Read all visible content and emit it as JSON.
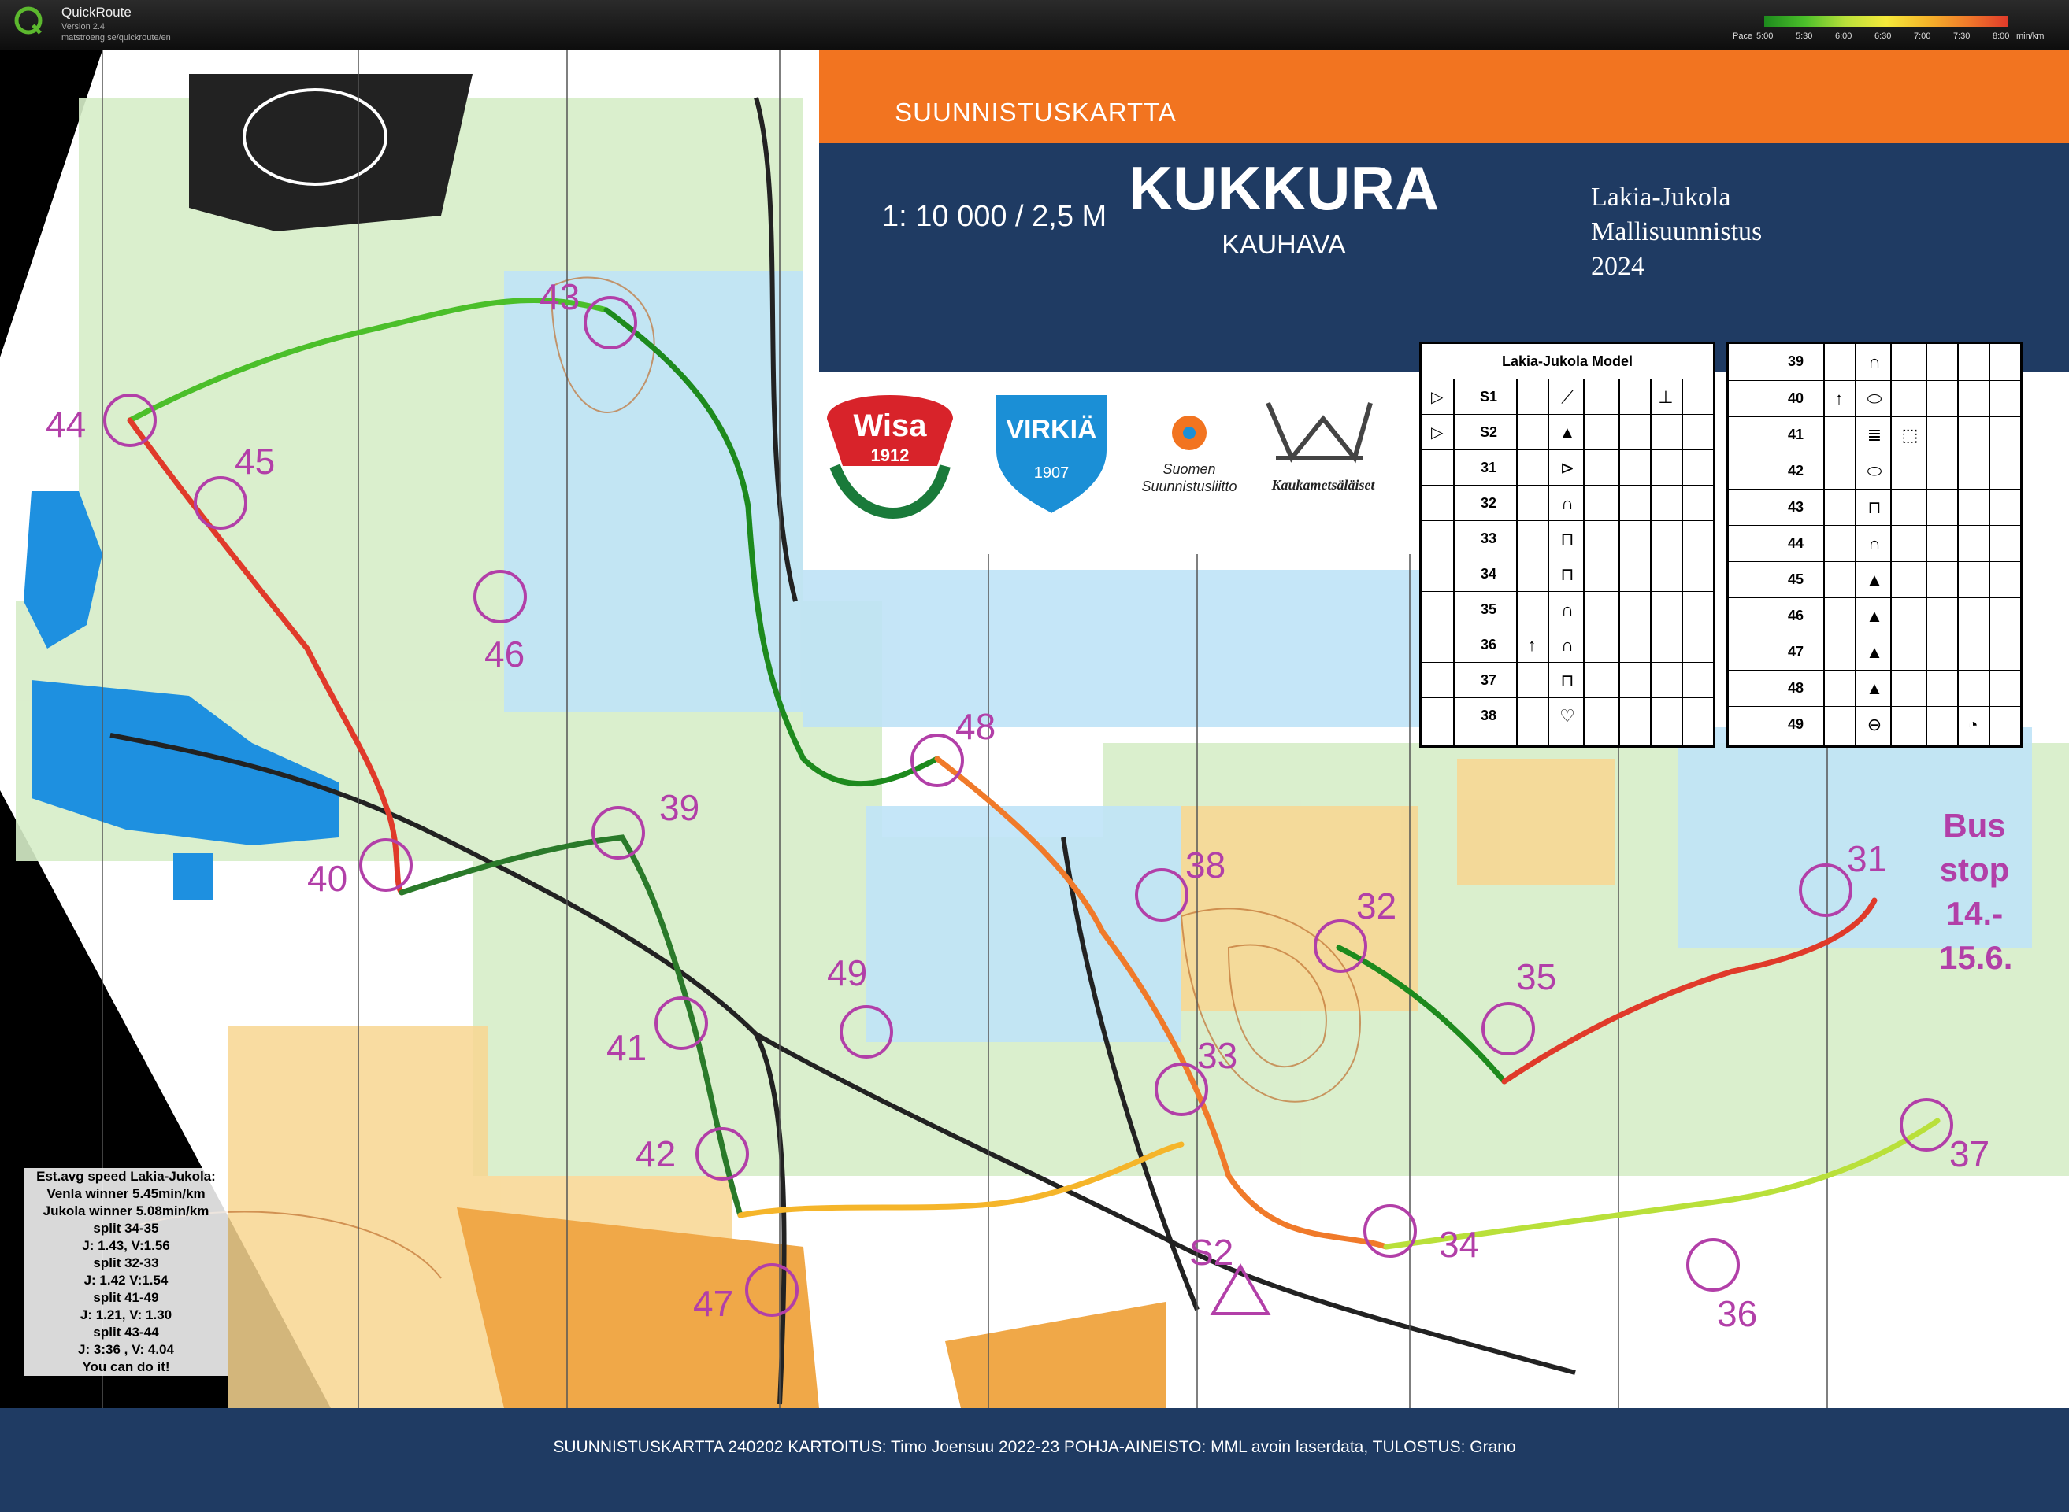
{
  "app": {
    "name": "QuickRoute",
    "version": "Version 2.4",
    "url": "matstroeng.se/quickroute/en"
  },
  "pace_legend": {
    "label_pace": "Pace",
    "ticks": [
      "5:00",
      "5:30",
      "6:00",
      "6:30",
      "7:00",
      "7:30",
      "8:00"
    ],
    "unit": "min/km",
    "colors": [
      "#1d8a1d",
      "#4bbf2a",
      "#b9e03a",
      "#f5e93a",
      "#f5b52a",
      "#f07a2a",
      "#e03a2a"
    ]
  },
  "map_header": {
    "top_banner": "SUUNNISTUSKARTTA",
    "scale": "1: 10 000 / 2,5 M",
    "title": "KUKKURA",
    "town": "KAUHAVA",
    "event_lines": [
      "Lakia-Jukola",
      "Mallisuunnistus",
      "2024"
    ],
    "orange_color": "#f27420",
    "blue_color": "#1f3b63"
  },
  "logos": {
    "wisa": "Wisa",
    "wisa_year": "1912",
    "virkia": "VIRKIÄ",
    "virkia_year": "1907",
    "ssl_line1": "Suomen",
    "ssl_line2": "Suunnistusliitto",
    "kaukametsalaiset": "Kaukametsäläiset"
  },
  "control_descriptions": {
    "title": "Lakia-Jukola Model",
    "left_rows": [
      {
        "num": "S1",
        "symbol": "⟋",
        "extra": "",
        "right": "⊥",
        "start": true
      },
      {
        "num": "S2",
        "symbol": "▲",
        "extra": "",
        "right": "",
        "start": true
      },
      {
        "num": "31",
        "symbol": "⊳",
        "extra": "",
        "right": ""
      },
      {
        "num": "32",
        "symbol": "∩",
        "extra": "",
        "right": ""
      },
      {
        "num": "33",
        "symbol": "⊓",
        "extra": "",
        "right": ""
      },
      {
        "num": "34",
        "symbol": "⊓",
        "extra": "",
        "right": ""
      },
      {
        "num": "35",
        "symbol": "∩",
        "extra": "",
        "right": ""
      },
      {
        "num": "36",
        "symbol": "∩",
        "extra": "↑",
        "right": ""
      },
      {
        "num": "37",
        "symbol": "⊓",
        "extra": "",
        "right": ""
      },
      {
        "num": "38",
        "symbol": "♡",
        "extra": "",
        "right": ""
      }
    ],
    "right_rows": [
      {
        "num": "39",
        "symbol": "∩",
        "extra": "",
        "right": ""
      },
      {
        "num": "40",
        "symbol": "⬭",
        "extra": "↑",
        "right": ""
      },
      {
        "num": "41",
        "symbol": "≣",
        "extra": "",
        "right": "⬚"
      },
      {
        "num": "42",
        "symbol": "⬭",
        "extra": "",
        "right": ""
      },
      {
        "num": "43",
        "symbol": "⊓",
        "extra": "",
        "right": ""
      },
      {
        "num": "44",
        "symbol": "∩",
        "extra": "",
        "right": ""
      },
      {
        "num": "45",
        "symbol": "▲",
        "extra": "",
        "right": ""
      },
      {
        "num": "46",
        "symbol": "▲",
        "extra": "",
        "right": ""
      },
      {
        "num": "47",
        "symbol": "▲",
        "extra": "",
        "right": ""
      },
      {
        "num": "48",
        "symbol": "▲",
        "extra": "",
        "right": ""
      },
      {
        "num": "49",
        "symbol": "⊖",
        "extra": "",
        "right": "◔"
      }
    ]
  },
  "controls": [
    {
      "id": "31",
      "label": "31"
    },
    {
      "id": "32",
      "label": "32"
    },
    {
      "id": "33",
      "label": "33"
    },
    {
      "id": "34",
      "label": "34"
    },
    {
      "id": "35",
      "label": "35"
    },
    {
      "id": "36",
      "label": "36"
    },
    {
      "id": "37",
      "label": "37"
    },
    {
      "id": "38",
      "label": "38"
    },
    {
      "id": "39",
      "label": "39"
    },
    {
      "id": "40",
      "label": "40"
    },
    {
      "id": "41",
      "label": "41"
    },
    {
      "id": "42",
      "label": "42"
    },
    {
      "id": "43",
      "label": "43"
    },
    {
      "id": "44",
      "label": "44"
    },
    {
      "id": "45",
      "label": "45"
    },
    {
      "id": "46",
      "label": "46"
    },
    {
      "id": "47",
      "label": "47"
    },
    {
      "id": "48",
      "label": "48"
    },
    {
      "id": "49",
      "label": "49"
    },
    {
      "id": "S2",
      "label": "S2"
    }
  ],
  "bus_stop": [
    "Bus",
    "stop",
    "14.-",
    "15.6."
  ],
  "speed_notes": [
    "Est.avg speed Lakia-Jukola:",
    "Venla winner 5.45min/km",
    "Jukola winner 5.08min/km",
    "split 34-35",
    "J: 1.43, V:1.56",
    "split 32-33",
    "J: 1.42 V:1.54",
    "split 41-49",
    "J: 1.21, V: 1.30",
    "split 43-44",
    "J: 3:36 , V: 4.04",
    "You can do it!"
  ],
  "footer": "SUUNNISTUSKARTTA 240202 KARTOITUS: Timo Joensuu 2022-23 POHJA-AINEISTO: MML avoin laserdata, TULOSTUS: Grano",
  "colors": {
    "control_magenta": "#b23fa8",
    "water": "#1e90e0",
    "open_yellow": "#f7c060",
    "forest_green": "#cfeac0",
    "contour_brown": "#c07030"
  }
}
